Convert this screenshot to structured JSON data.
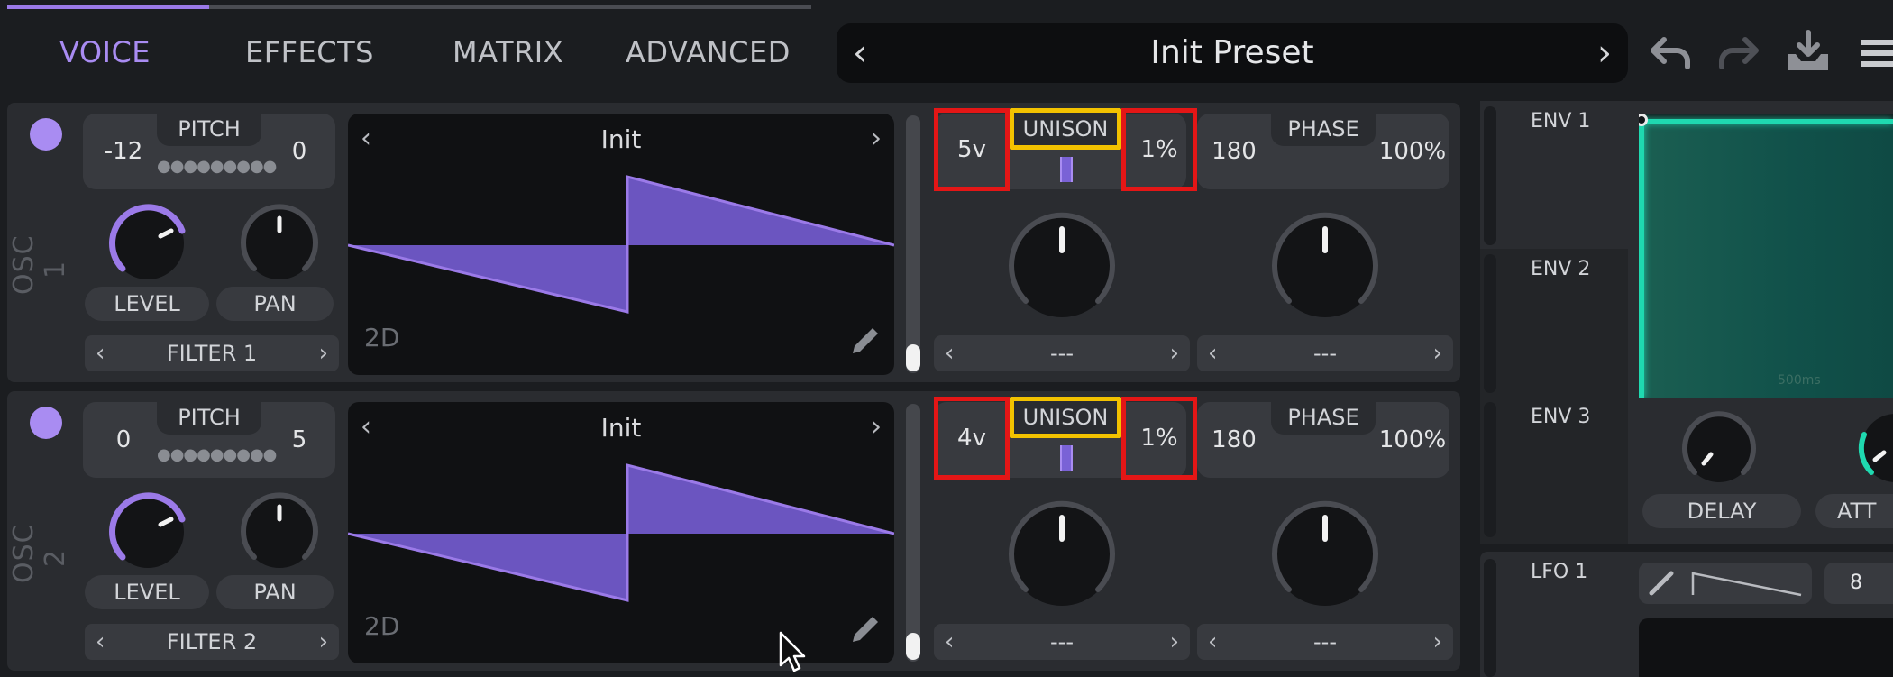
{
  "tabs": [
    {
      "label": "VOICE",
      "active": true
    },
    {
      "label": "EFFECTS",
      "active": false
    },
    {
      "label": "MATRIX",
      "active": false
    },
    {
      "label": "ADVANCED",
      "active": false
    }
  ],
  "preset": {
    "name": "Init Preset"
  },
  "toolbar": {
    "icons": [
      "undo-icon",
      "redo-icon",
      "save-icon",
      "menu-icon"
    ]
  },
  "oscillators": [
    {
      "label": "OSC 1",
      "pitch_label": "PITCH",
      "pitch_left": "-12",
      "pitch_right": "0",
      "level_label": "LEVEL",
      "pan_label": "PAN",
      "filter_label": "FILTER 1",
      "wave_name": "Init",
      "wave_mode": "2D",
      "unison_voices": "5v",
      "unison_label": "UNISON",
      "unison_detune": "1%",
      "phase_left": "180",
      "phase_label": "PHASE",
      "phase_right": "100%",
      "dest1": "---",
      "dest2": "---"
    },
    {
      "label": "OSC 2",
      "pitch_label": "PITCH",
      "pitch_left": "0",
      "pitch_right": "5",
      "level_label": "LEVEL",
      "pan_label": "PAN",
      "filter_label": "FILTER 2",
      "wave_name": "Init",
      "wave_mode": "2D",
      "unison_voices": "4v",
      "unison_label": "UNISON",
      "unison_detune": "1%",
      "phase_left": "180",
      "phase_label": "PHASE",
      "phase_right": "100%",
      "dest1": "---",
      "dest2": "---"
    }
  ],
  "envelopes": {
    "items": [
      "ENV 1",
      "ENV 2",
      "ENV 3"
    ],
    "delay_label": "DELAY",
    "attack_label_partial": "ATT",
    "time_label": "500ms"
  },
  "lfo": {
    "label": "LFO 1",
    "value": "8"
  },
  "colors": {
    "accent": "#a98cf2",
    "env_teal": "#1fd9b0",
    "highlight_red": "#e41616",
    "highlight_yellow": "#f2c200"
  }
}
